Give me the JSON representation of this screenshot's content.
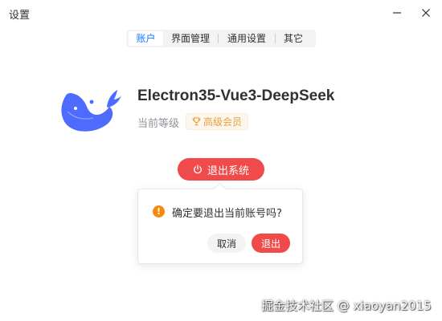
{
  "window": {
    "title": "设置",
    "minimize_icon": "minimize-icon",
    "close_icon": "close-icon"
  },
  "tabs": [
    {
      "label": "账户",
      "active": true
    },
    {
      "label": "界面管理",
      "active": false
    },
    {
      "label": "通用设置",
      "active": false
    },
    {
      "label": "其它",
      "active": false
    }
  ],
  "account": {
    "app_name": "Electron35-Vue3-DeepSeek",
    "level_label": "当前等级",
    "badge_icon": "trophy-icon",
    "badge_label": "高级会员"
  },
  "logout": {
    "icon": "power-icon",
    "label": "退出系统"
  },
  "popconfirm": {
    "icon": "warning-icon",
    "message": "确定要退出当前账号吗?",
    "cancel_label": "取消",
    "confirm_label": "退出"
  },
  "watermark": "掘金技术社区 @ xiaoyan2015",
  "colors": {
    "accent": "#1677ff",
    "danger": "#f04a4a",
    "warning": "#f7890b",
    "logo_blue": "#4d6bfe",
    "badge_text": "#e6a23c"
  }
}
